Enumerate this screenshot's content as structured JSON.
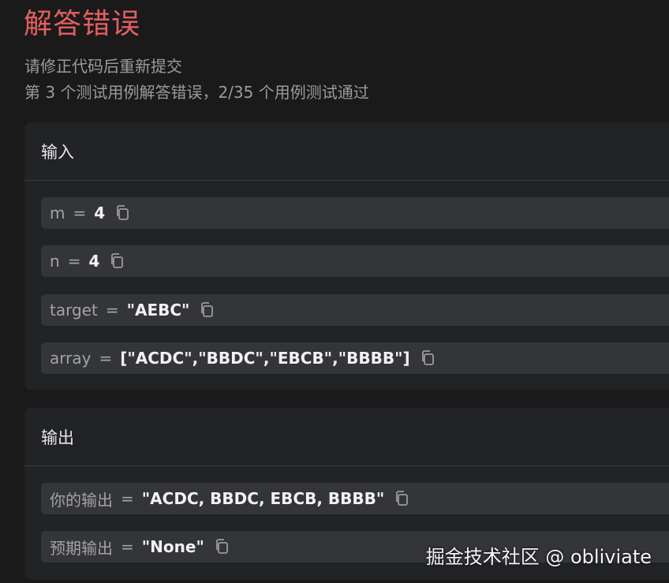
{
  "result": {
    "title": "解答错误",
    "hint": "请修正代码后重新提交",
    "summary": "第 3 个测试用例解答错误，2/35 个用例测试通过"
  },
  "input_panel": {
    "header": "输入",
    "rows": [
      {
        "name": "m",
        "value": "4"
      },
      {
        "name": "n",
        "value": "4"
      },
      {
        "name": "target",
        "value": "\"AEBC\""
      },
      {
        "name": "array",
        "value": "[\"ACDC\",\"BBDC\",\"EBCB\",\"BBBB\"]"
      }
    ]
  },
  "output_panel": {
    "header": "输出",
    "rows": [
      {
        "name": "你的输出",
        "value": "\"ACDC, BBDC, EBCB, BBBB\""
      },
      {
        "name": "预期输出",
        "value": "\"None\""
      }
    ]
  },
  "equals_sign": "=",
  "watermark": "掘金技术社区 @ obliviate",
  "colors": {
    "error_title": "#e35f62",
    "panel_bg": "#222326",
    "row_bg": "#333539",
    "page_bg": "#1a1a1a"
  },
  "icons": {
    "copy": "copy-icon"
  }
}
